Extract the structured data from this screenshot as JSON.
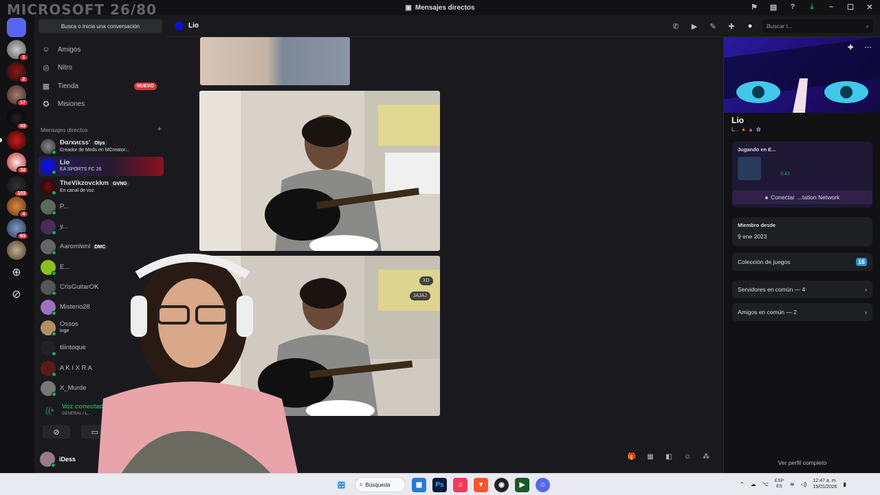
{
  "titlebar": {
    "title": "Mensajes directos",
    "watermark": "MICROSOFT 26/80"
  },
  "servers": [
    {
      "badge": "1"
    },
    {
      "badge": "2"
    },
    {
      "badge": "17"
    },
    {
      "badge": "43"
    },
    {
      "badge": ""
    },
    {
      "badge": "32"
    },
    {
      "badge": "103"
    },
    {
      "badge": "4"
    },
    {
      "badge": "63"
    },
    {
      "badge": ""
    }
  ],
  "dm_panel": {
    "search_placeholder": "Busca o inicia una conversación",
    "nav": [
      {
        "label": "Amigos",
        "icon": "friends-icon"
      },
      {
        "label": "Nitro",
        "icon": "nitro-icon"
      },
      {
        "label": "Tienda",
        "icon": "shop-icon",
        "badge": "NUEVO"
      },
      {
        "label": "Misiones",
        "icon": "quests-icon"
      }
    ],
    "dm_header": "Mensajes directos",
    "dms": [
      {
        "name": "Ɖαɾкиεss'",
        "tag": "Olys",
        "sub": "Creador de Mods en MCreator..."
      },
      {
        "name": "Lio",
        "tag": "",
        "sub": "EA SPORTS FC 26"
      },
      {
        "name": "TheVikzovckkm",
        "tag": "GVNG",
        "sub": "En canal de voz"
      },
      {
        "name": "P...",
        "tag": "",
        "sub": ""
      },
      {
        "name": "y...",
        "tag": "",
        "sub": ""
      },
      {
        "name": "Aaromiwnl",
        "tag": "DMC",
        "sub": ""
      },
      {
        "name": "E...",
        "tag": "",
        "sub": ""
      },
      {
        "name": "CrisGuitarOK",
        "tag": "",
        "sub": ""
      },
      {
        "name": "Misterio28",
        "tag": "",
        "sub": ""
      },
      {
        "name": "Ossos",
        "tag": "",
        "sub": "inge"
      },
      {
        "name": "tilintoque",
        "tag": "",
        "sub": ""
      },
      {
        "name": "A K I X R A",
        "tag": "",
        "sub": ""
      },
      {
        "name": "X_Murde",
        "tag": "",
        "sub": ""
      }
    ],
    "voice": {
      "title": "Voz conectada",
      "sub": "GENERAL / L..."
    },
    "user": {
      "name": "iDess"
    }
  },
  "header": {
    "user": "Lio",
    "search_placeholder": "Buscar l..."
  },
  "chat": {
    "xd_label": "XD",
    "jajaj_label": "JAJAJ"
  },
  "profile": {
    "name": "Lio",
    "sub": "L...",
    "playing_label": "Jugando en E...",
    "playing_time": "3:43",
    "connect_label": "Conectar",
    "connect_suffix": "...tation Network",
    "member_since_label": "Miembro desde",
    "member_since_value": "9 ene 2023",
    "games_label": "Colección de juegos",
    "games_count": "16",
    "servers_common": "Servidores en común — 4",
    "friends_common": "Amigos en común — 2",
    "full_profile": "Ver perfil completo"
  },
  "taskbar": {
    "search_label": "Búsqueda",
    "lang_top": "ESP",
    "lang_bottom": "ES",
    "time": "12:47 a. m.",
    "date": "15/01/2026"
  }
}
